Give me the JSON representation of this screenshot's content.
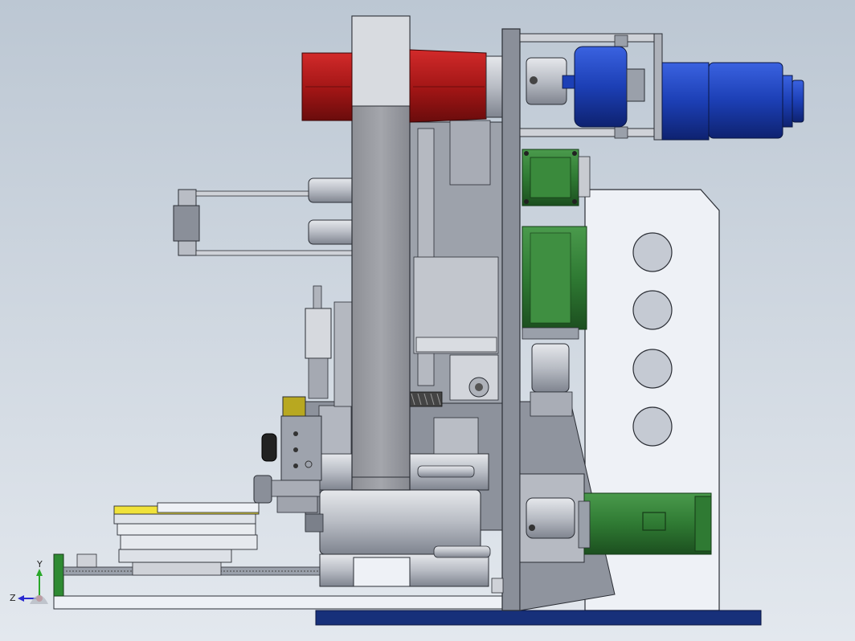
{
  "viewport": {
    "background_top": "#bcc7d3",
    "background_bottom": "#e3e8ee"
  },
  "colors": {
    "metal_light": "#cfd2d8",
    "metal_mid": "#a9adb6",
    "metal_dark": "#6e7380",
    "edge": "#2b2e35",
    "red_roller": "#b01c1c",
    "blue_motor": "#1c3fb5",
    "green_motor": "#2f7a33",
    "yellow_part": "#f0e23a",
    "base_navy": "#17307a",
    "plate_white": "#eef1f6"
  },
  "triad": {
    "y_label": "Y",
    "z_label": "Z",
    "y_color": "#2aa82a",
    "z_color": "#2a2ad0",
    "x_color": "#d02a2a"
  }
}
